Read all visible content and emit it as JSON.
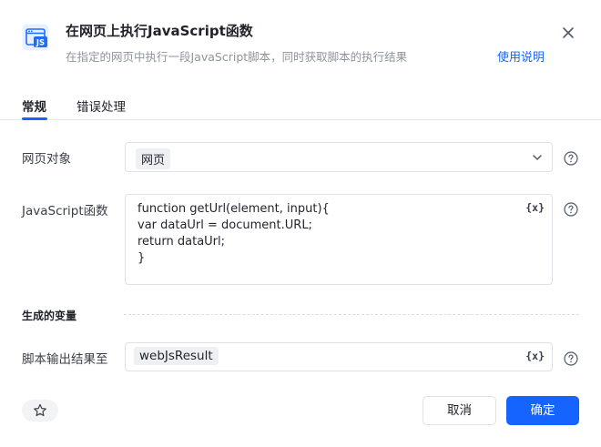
{
  "header": {
    "icon_name": "javascript-browser-icon",
    "icon_text": "JS",
    "title": "在网页上执行JavaScript函数",
    "subtitle": "在指定的网页中执行一段JavaScript脚本，同时获取脚本的执行结果",
    "help_link": "使用说明"
  },
  "tabs": [
    {
      "label": "常规",
      "active": true
    },
    {
      "label": "错误处理",
      "active": false
    }
  ],
  "form": {
    "page_object": {
      "label": "网页对象",
      "value": "网页"
    },
    "js_function": {
      "label": "JavaScript函数",
      "code_lines": [
        "function getUrl(element, input){",
        "var dataUrl = document.URL;",
        "return dataUrl;",
        "}"
      ],
      "var_button": "{x}"
    },
    "generated_vars_title": "生成的变量",
    "output": {
      "label": "脚本输出结果至",
      "value": "webJsResult",
      "var_button": "{x}"
    }
  },
  "footer": {
    "cancel_label": "取消",
    "ok_label": "确定"
  },
  "colors": {
    "accent": "#1664ff",
    "icon_blue": "#1e6ef5",
    "border": "#dfe1e6"
  }
}
